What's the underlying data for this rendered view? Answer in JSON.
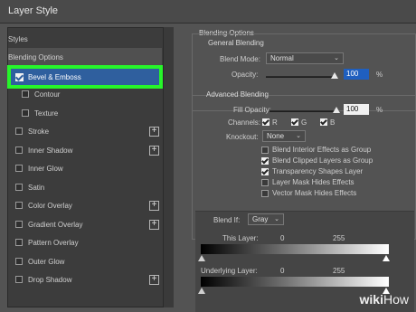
{
  "window": {
    "title": "Layer Style"
  },
  "left_panel": {
    "styles_label": "Styles",
    "blending_options_label": "Blending Options",
    "items": [
      {
        "label": "Bevel & Emboss",
        "checked": true,
        "selected": true,
        "has_add": false
      },
      {
        "label": "Contour",
        "checked": false,
        "has_add": false
      },
      {
        "label": "Texture",
        "checked": false,
        "has_add": false
      },
      {
        "label": "Stroke",
        "checked": false,
        "has_add": true
      },
      {
        "label": "Inner Shadow",
        "checked": false,
        "has_add": true
      },
      {
        "label": "Inner Glow",
        "checked": false,
        "has_add": false
      },
      {
        "label": "Satin",
        "checked": false,
        "has_add": false
      },
      {
        "label": "Color Overlay",
        "checked": false,
        "has_add": true
      },
      {
        "label": "Gradient Overlay",
        "checked": false,
        "has_add": true
      },
      {
        "label": "Pattern Overlay",
        "checked": false,
        "has_add": false
      },
      {
        "label": "Outer Glow",
        "checked": false,
        "has_add": false
      },
      {
        "label": "Drop Shadow",
        "checked": false,
        "has_add": true
      }
    ],
    "add_icon": "plus-icon",
    "highlight_color": "#27f52a"
  },
  "blending_options": {
    "title": "Blending Options",
    "general": {
      "title": "General Blending",
      "blend_mode_label": "Blend Mode:",
      "blend_mode_value": "Normal",
      "opacity_label": "Opacity:",
      "opacity_value": "100",
      "opacity_unit": "%"
    },
    "advanced": {
      "title": "Advanced Blending",
      "fill_opacity_label": "Fill Opacity:",
      "fill_opacity_value": "100",
      "fill_opacity_unit": "%",
      "channels_label": "Channels:",
      "channels": [
        "R",
        "G",
        "B"
      ],
      "knockout_label": "Knockout:",
      "knockout_value": "None",
      "options": [
        {
          "label": "Blend Interior Effects as Group",
          "checked": false
        },
        {
          "label": "Blend Clipped Layers as Group",
          "checked": true
        },
        {
          "label": "Transparency Shapes Layer",
          "checked": true
        },
        {
          "label": "Layer Mask Hides Effects",
          "checked": false
        },
        {
          "label": "Vector Mask Hides Effects",
          "checked": false
        }
      ]
    },
    "blend_if": {
      "label": "Blend If:",
      "value": "Gray",
      "this_layer_label": "This Layer:",
      "this_layer_min": "0",
      "this_layer_max": "255",
      "underlying_label": "Underlying Layer:",
      "underlying_min": "0",
      "underlying_max": "255"
    }
  },
  "watermark": {
    "wiki": "wiki",
    "how": "How"
  }
}
